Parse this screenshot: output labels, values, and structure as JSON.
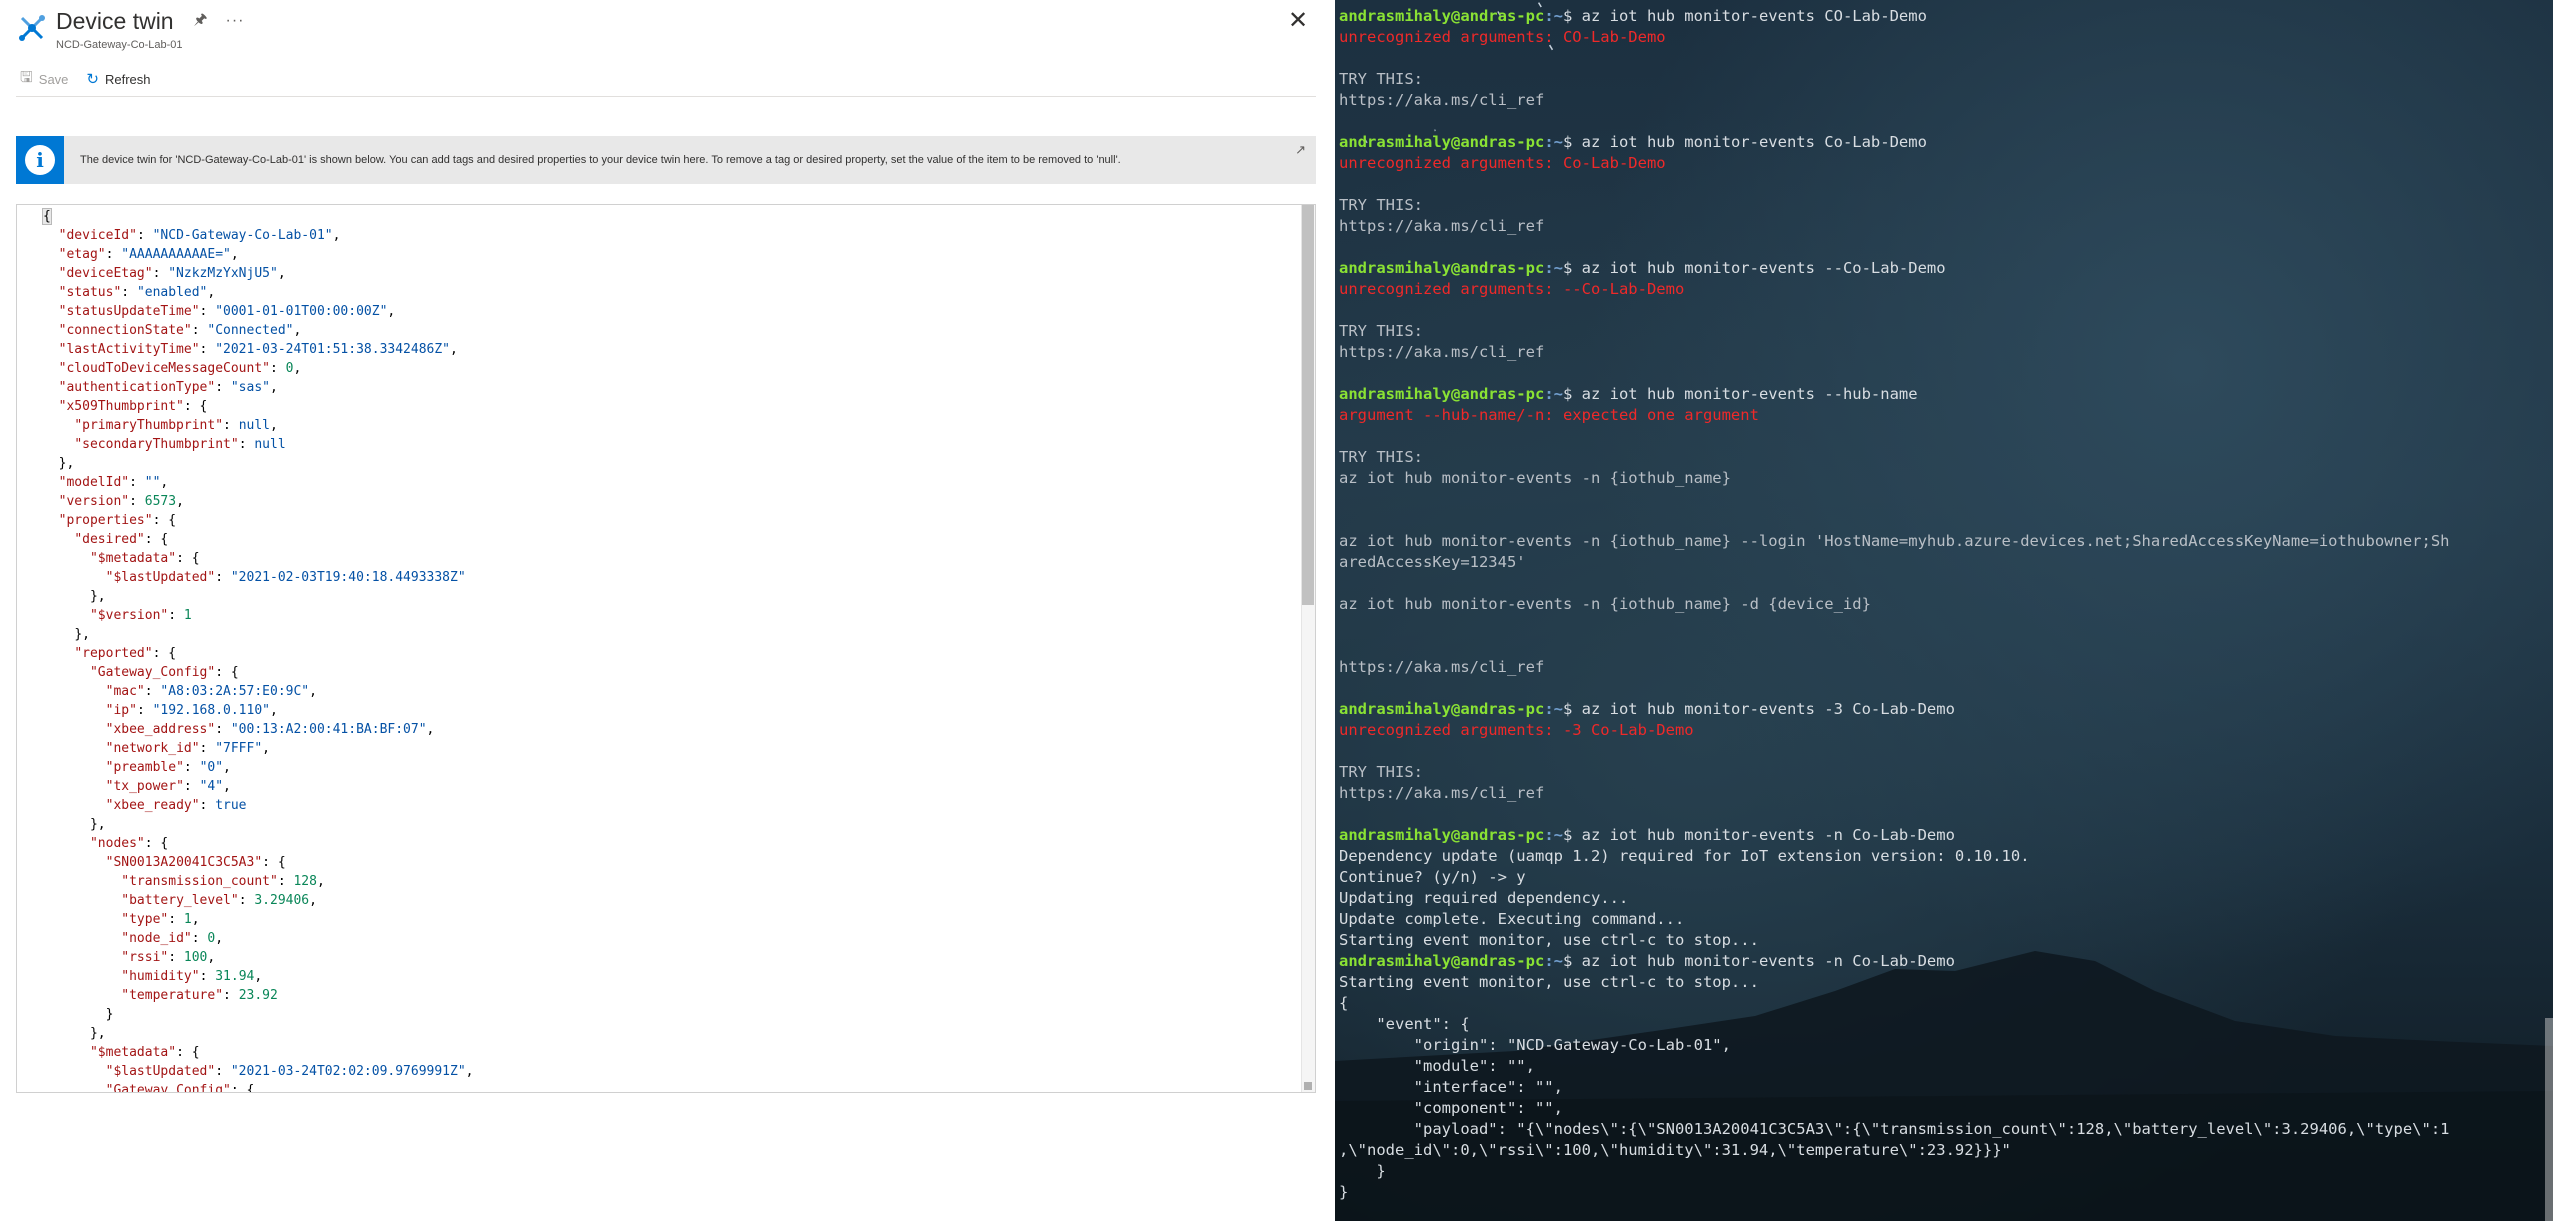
{
  "blade": {
    "title": "Device twin",
    "subtitle": "NCD-Gateway-Co-Lab-01",
    "pin_icon": "pin-icon",
    "more_icon": "ellipsis-icon",
    "close_icon": "close-icon",
    "toolbar": {
      "save_label": "Save",
      "refresh_label": "Refresh"
    },
    "info_banner": {
      "icon": "info-icon",
      "text": "The device twin for 'NCD-Gateway-Co-Lab-01' is shown below. You can add tags and desired properties to your device twin here. To remove a tag or desired property, set the value of the item to be removed to 'null'.",
      "external_icon": "open-external-icon"
    },
    "twin_json_lines": [
      {
        "indent": 0,
        "key": "",
        "value": "{",
        "vtype": "p"
      },
      {
        "indent": 1,
        "key": "deviceId",
        "value": "\"NCD-Gateway-Co-Lab-01\"",
        "vtype": "s",
        "comma": true
      },
      {
        "indent": 1,
        "key": "etag",
        "value": "\"AAAAAAAAAAE=\"",
        "vtype": "s",
        "comma": true
      },
      {
        "indent": 1,
        "key": "deviceEtag",
        "value": "\"NzkzMzYxNjU5\"",
        "vtype": "s",
        "comma": true
      },
      {
        "indent": 1,
        "key": "status",
        "value": "\"enabled\"",
        "vtype": "s",
        "comma": true
      },
      {
        "indent": 1,
        "key": "statusUpdateTime",
        "value": "\"0001-01-01T00:00:00Z\"",
        "vtype": "s",
        "comma": true
      },
      {
        "indent": 1,
        "key": "connectionState",
        "value": "\"Connected\"",
        "vtype": "s",
        "comma": true
      },
      {
        "indent": 1,
        "key": "lastActivityTime",
        "value": "\"2021-03-24T01:51:38.3342486Z\"",
        "vtype": "s",
        "comma": true
      },
      {
        "indent": 1,
        "key": "cloudToDeviceMessageCount",
        "value": "0",
        "vtype": "n",
        "comma": true
      },
      {
        "indent": 1,
        "key": "authenticationType",
        "value": "\"sas\"",
        "vtype": "s",
        "comma": true
      },
      {
        "indent": 1,
        "key": "x509Thumbprint",
        "value": "{",
        "vtype": "p"
      },
      {
        "indent": 2,
        "key": "primaryThumbprint",
        "value": "null",
        "vtype": "b",
        "comma": true
      },
      {
        "indent": 2,
        "key": "secondaryThumbprint",
        "value": "null",
        "vtype": "b"
      },
      {
        "indent": 1,
        "key": "",
        "value": "},",
        "vtype": "p"
      },
      {
        "indent": 1,
        "key": "modelId",
        "value": "\"\"",
        "vtype": "s",
        "comma": true
      },
      {
        "indent": 1,
        "key": "version",
        "value": "6573",
        "vtype": "n",
        "comma": true
      },
      {
        "indent": 1,
        "key": "properties",
        "value": "{",
        "vtype": "p"
      },
      {
        "indent": 2,
        "key": "desired",
        "value": "{",
        "vtype": "p"
      },
      {
        "indent": 3,
        "key": "$metadata",
        "value": "{",
        "vtype": "p"
      },
      {
        "indent": 4,
        "key": "$lastUpdated",
        "value": "\"2021-02-03T19:40:18.4493338Z\"",
        "vtype": "s"
      },
      {
        "indent": 3,
        "key": "",
        "value": "},",
        "vtype": "p"
      },
      {
        "indent": 3,
        "key": "$version",
        "value": "1",
        "vtype": "n"
      },
      {
        "indent": 2,
        "key": "",
        "value": "},",
        "vtype": "p"
      },
      {
        "indent": 2,
        "key": "reported",
        "value": "{",
        "vtype": "p"
      },
      {
        "indent": 3,
        "key": "Gateway_Config",
        "value": "{",
        "vtype": "p"
      },
      {
        "indent": 4,
        "key": "mac",
        "value": "\"A8:03:2A:57:E0:9C\"",
        "vtype": "s",
        "comma": true
      },
      {
        "indent": 4,
        "key": "ip",
        "value": "\"192.168.0.110\"",
        "vtype": "s",
        "comma": true
      },
      {
        "indent": 4,
        "key": "xbee_address",
        "value": "\"00:13:A2:00:41:BA:BF:07\"",
        "vtype": "s",
        "comma": true
      },
      {
        "indent": 4,
        "key": "network_id",
        "value": "\"7FFF\"",
        "vtype": "s",
        "comma": true
      },
      {
        "indent": 4,
        "key": "preamble",
        "value": "\"0\"",
        "vtype": "s",
        "comma": true
      },
      {
        "indent": 4,
        "key": "tx_power",
        "value": "\"4\"",
        "vtype": "s",
        "comma": true
      },
      {
        "indent": 4,
        "key": "xbee_ready",
        "value": "true",
        "vtype": "b"
      },
      {
        "indent": 3,
        "key": "",
        "value": "},",
        "vtype": "p"
      },
      {
        "indent": 3,
        "key": "nodes",
        "value": "{",
        "vtype": "p"
      },
      {
        "indent": 4,
        "key": "SN0013A20041C3C5A3",
        "value": "{",
        "vtype": "p"
      },
      {
        "indent": 5,
        "key": "transmission_count",
        "value": "128",
        "vtype": "n",
        "comma": true
      },
      {
        "indent": 5,
        "key": "battery_level",
        "value": "3.29406",
        "vtype": "n",
        "comma": true
      },
      {
        "indent": 5,
        "key": "type",
        "value": "1",
        "vtype": "n",
        "comma": true
      },
      {
        "indent": 5,
        "key": "node_id",
        "value": "0",
        "vtype": "n",
        "comma": true
      },
      {
        "indent": 5,
        "key": "rssi",
        "value": "100",
        "vtype": "n",
        "comma": true
      },
      {
        "indent": 5,
        "key": "humidity",
        "value": "31.94",
        "vtype": "n",
        "comma": true
      },
      {
        "indent": 5,
        "key": "temperature",
        "value": "23.92",
        "vtype": "n"
      },
      {
        "indent": 4,
        "key": "",
        "value": "}",
        "vtype": "p"
      },
      {
        "indent": 3,
        "key": "",
        "value": "},",
        "vtype": "p"
      },
      {
        "indent": 3,
        "key": "$metadata",
        "value": "{",
        "vtype": "p"
      },
      {
        "indent": 4,
        "key": "$lastUpdated",
        "value": "\"2021-03-24T02:02:09.9769991Z\"",
        "vtype": "s",
        "comma": true
      },
      {
        "indent": 4,
        "key": "Gateway_Config",
        "value": "{",
        "vtype": "p"
      }
    ]
  },
  "terminal": {
    "prompt_user": "andrasmihaly@andras-pc",
    "prompt_path": ":~",
    "lines": [
      {
        "type": "prompt",
        "cmd": "az iot hub monitor-events CO-Lab-Demo"
      },
      {
        "type": "err",
        "text": "unrecognized arguments: CO-Lab-Demo"
      },
      {
        "type": "blank"
      },
      {
        "type": "dim",
        "text": "TRY THIS:"
      },
      {
        "type": "dim",
        "text": "https://aka.ms/cli_ref"
      },
      {
        "type": "blank"
      },
      {
        "type": "prompt",
        "cmd": "az iot hub monitor-events Co-Lab-Demo"
      },
      {
        "type": "err",
        "text": "unrecognized arguments: Co-Lab-Demo"
      },
      {
        "type": "blank"
      },
      {
        "type": "dim",
        "text": "TRY THIS:"
      },
      {
        "type": "dim",
        "text": "https://aka.ms/cli_ref"
      },
      {
        "type": "blank"
      },
      {
        "type": "prompt",
        "cmd": "az iot hub monitor-events --Co-Lab-Demo"
      },
      {
        "type": "err",
        "text": "unrecognized arguments: --Co-Lab-Demo"
      },
      {
        "type": "blank"
      },
      {
        "type": "dim",
        "text": "TRY THIS:"
      },
      {
        "type": "dim",
        "text": "https://aka.ms/cli_ref"
      },
      {
        "type": "blank"
      },
      {
        "type": "prompt",
        "cmd": "az iot hub monitor-events --hub-name"
      },
      {
        "type": "err",
        "text": "argument --hub-name/-n: expected one argument"
      },
      {
        "type": "blank"
      },
      {
        "type": "dim",
        "text": "TRY THIS:"
      },
      {
        "type": "dim",
        "text": "az iot hub monitor-events -n {iothub_name}"
      },
      {
        "type": "blank"
      },
      {
        "type": "blank"
      },
      {
        "type": "dim",
        "text": "az iot hub monitor-events -n {iothub_name} --login 'HostName=myhub.azure-devices.net;SharedAccessKeyName=iothubowner;Sh"
      },
      {
        "type": "dim",
        "text": "aredAccessKey=12345'"
      },
      {
        "type": "blank"
      },
      {
        "type": "dim",
        "text": "az iot hub monitor-events -n {iothub_name} -d {device_id}"
      },
      {
        "type": "blank"
      },
      {
        "type": "blank"
      },
      {
        "type": "dim",
        "text": "https://aka.ms/cli_ref"
      },
      {
        "type": "blank"
      },
      {
        "type": "prompt",
        "cmd": "az iot hub monitor-events -3 Co-Lab-Demo"
      },
      {
        "type": "err",
        "text": "unrecognized arguments: -3 Co-Lab-Demo"
      },
      {
        "type": "blank"
      },
      {
        "type": "dim",
        "text": "TRY THIS:"
      },
      {
        "type": "dim",
        "text": "https://aka.ms/cli_ref"
      },
      {
        "type": "blank"
      },
      {
        "type": "prompt",
        "cmd": "az iot hub monitor-events -n Co-Lab-Demo"
      },
      {
        "type": "out",
        "text": "Dependency update (uamqp 1.2) required for IoT extension version: 0.10.10."
      },
      {
        "type": "out",
        "text": "Continue? (y/n) -> y"
      },
      {
        "type": "out",
        "text": "Updating required dependency..."
      },
      {
        "type": "out",
        "text": "Update complete. Executing command..."
      },
      {
        "type": "out",
        "text": "Starting event monitor, use ctrl-c to stop..."
      },
      {
        "type": "prompt",
        "cmd": "az iot hub monitor-events -n Co-Lab-Demo"
      },
      {
        "type": "out",
        "text": "Starting event monitor, use ctrl-c to stop..."
      },
      {
        "type": "out",
        "text": "{"
      },
      {
        "type": "out",
        "text": "    \"event\": {"
      },
      {
        "type": "out",
        "text": "        \"origin\": \"NCD-Gateway-Co-Lab-01\","
      },
      {
        "type": "out",
        "text": "        \"module\": \"\","
      },
      {
        "type": "out",
        "text": "        \"interface\": \"\","
      },
      {
        "type": "out",
        "text": "        \"component\": \"\","
      },
      {
        "type": "out",
        "text": "        \"payload\": \"{\\\"nodes\\\":{\\\"SN0013A20041C3C5A3\\\":{\\\"transmission_count\\\":128,\\\"battery_level\\\":3.29406,\\\"type\\\":1"
      },
      {
        "type": "out",
        "text": ",\\\"node_id\\\":0,\\\"rssi\\\":100,\\\"humidity\\\":31.94,\\\"temperature\\\":23.92}}}\""
      },
      {
        "type": "out",
        "text": "    }"
      },
      {
        "type": "out",
        "text": "}"
      }
    ]
  }
}
